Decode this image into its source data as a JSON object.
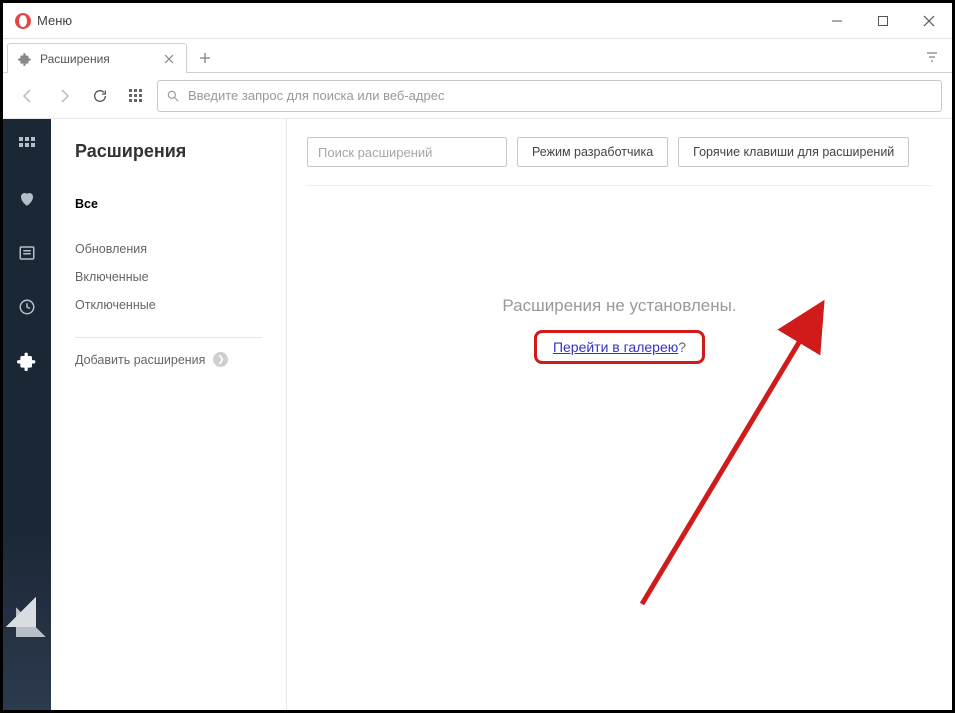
{
  "titlebar": {
    "menu_label": "Меню"
  },
  "tabbar": {
    "tab_title": "Расширения"
  },
  "toolbar": {
    "address_placeholder": "Введите запрос для поиска или веб-адрес"
  },
  "leftpane": {
    "heading": "Расширения",
    "filters": {
      "all": "Все",
      "updates": "Обновления",
      "enabled": "Включенные",
      "disabled": "Отключенные"
    },
    "add_extensions": "Добавить расширения"
  },
  "mainpane": {
    "search_placeholder": "Поиск расширений",
    "dev_mode": "Режим разработчика",
    "hotkeys": "Горячие клавиши для расширений",
    "empty_title": "Расширения не установлены.",
    "gallery_link": "Перейти в галерею",
    "gallery_q": "?"
  }
}
